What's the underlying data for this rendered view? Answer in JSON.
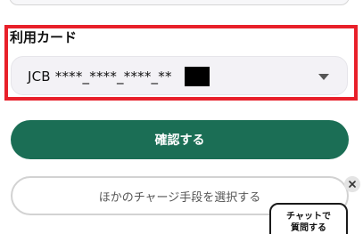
{
  "card_section": {
    "label": "利用カード",
    "selected_card": "JCB ****_****_****_**"
  },
  "buttons": {
    "confirm_label": "確認する",
    "other_method_label": "ほかのチャージ手段を選択する"
  },
  "chat": {
    "line1": "チャットで",
    "line2": "質問する",
    "close_icon": "close-icon"
  },
  "colors": {
    "highlight": "#e8202a",
    "primary": "#1b6e55"
  }
}
